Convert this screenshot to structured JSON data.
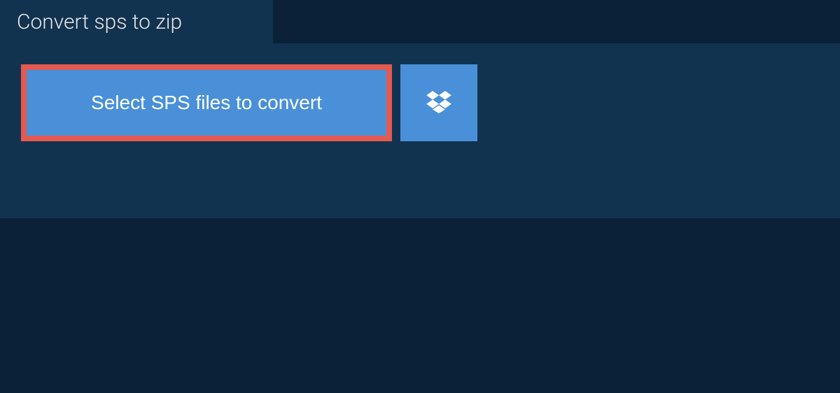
{
  "tab": {
    "title": "Convert sps to zip"
  },
  "actions": {
    "select_button_label": "Select SPS files to convert"
  },
  "colors": {
    "background_outer": "#0b2138",
    "background_inner": "#12334f",
    "button_primary": "#4990d9",
    "highlight_border": "#e45a50"
  }
}
